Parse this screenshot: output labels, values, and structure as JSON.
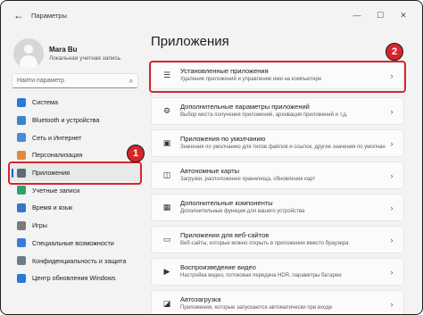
{
  "window": {
    "title": "Параметры",
    "back_glyph": "←",
    "minimize_glyph": "—",
    "maximize_glyph": "☐",
    "close_glyph": "✕"
  },
  "profile": {
    "name": "Mara Bu",
    "subtitle": "Локальная учетная запись"
  },
  "search": {
    "placeholder": "Найти параметр",
    "icon": "search-icon",
    "icon_glyph": "⌕"
  },
  "sidebar": {
    "active_index": 5,
    "items": [
      {
        "label": "Система",
        "icon": "system-icon",
        "color": "#2b79d6"
      },
      {
        "label": "Bluetooth и устройства",
        "icon": "bluetooth-icon",
        "color": "#3a86c8"
      },
      {
        "label": "Сеть и Интернет",
        "icon": "wifi-icon",
        "color": "#4b8bd4"
      },
      {
        "label": "Персонализация",
        "icon": "brush-icon",
        "color": "#e08a3c"
      },
      {
        "label": "Приложения",
        "icon": "apps-icon",
        "color": "#5a6b7b"
      },
      {
        "label": "Учетные записи",
        "icon": "account-icon",
        "color": "#2ea36b"
      },
      {
        "label": "Время и язык",
        "icon": "globe-icon",
        "color": "#3278c6"
      },
      {
        "label": "Игры",
        "icon": "gamepad-icon",
        "color": "#7a7a7a"
      },
      {
        "label": "Специальные возможности",
        "icon": "accessibility-icon",
        "color": "#3a7bd5"
      },
      {
        "label": "Конфиденциальность и защита",
        "icon": "shield-icon",
        "color": "#6c7a89"
      },
      {
        "label": "Центр обновления Windows",
        "icon": "update-icon",
        "color": "#2b79d6"
      }
    ]
  },
  "main": {
    "title": "Приложения",
    "chevron_glyph": "›",
    "cards": [
      {
        "title": "Установленные приложения",
        "subtitle": "Удаление приложений и управление ими на компьютере",
        "icon": "list-icon",
        "glyph": "☰"
      },
      {
        "title": "Дополнительные параметры приложений",
        "subtitle": "Выбор места получения приложений, архивация приложений и т.д.",
        "icon": "app-settings-icon",
        "glyph": "⚙"
      },
      {
        "title": "Приложения по умолчанию",
        "subtitle": "Значения по умолчанию для типов файлов и ссылок, другие значения по умолчанию",
        "icon": "default-apps-icon",
        "glyph": "▣"
      },
      {
        "title": "Автономные карты",
        "subtitle": "Загрузки, расположение хранилища, обновления карт",
        "icon": "map-icon",
        "glyph": "◫"
      },
      {
        "title": "Дополнительные компоненты",
        "subtitle": "Дополнительные функции для вашего устройства",
        "icon": "components-icon",
        "glyph": "▦"
      },
      {
        "title": "Приложения для веб-сайтов",
        "subtitle": "Веб-сайты, которые можно открыть в приложении вместо браузера",
        "icon": "web-apps-icon",
        "glyph": "▭"
      },
      {
        "title": "Воспроизведение видео",
        "subtitle": "Настройка видео, потоковая передача HDR, параметры батареи",
        "icon": "video-icon",
        "glyph": "▶"
      },
      {
        "title": "Автозагрузка",
        "subtitle": "Приложения, которые запускаются автоматически при входе",
        "icon": "startup-icon",
        "glyph": "◪"
      }
    ]
  },
  "annotations": {
    "step1": "1",
    "step2": "2",
    "color": "#d6262b"
  }
}
